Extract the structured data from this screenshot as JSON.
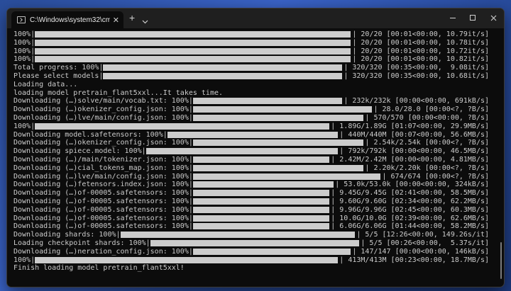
{
  "window": {
    "tab_title": "C:\\Windows\\system32\\cmd.e",
    "new_tab": "+",
    "colors": {
      "background": "#0c0c0c",
      "text": "#cccccc",
      "titlebar": "#1f1f1f"
    }
  },
  "terminal": {
    "lines": [
      {
        "type": "bar",
        "pre": "100%|",
        "post": "| 20/20 [00:01<00:00, 10.79it/s]",
        "progress": 1.0
      },
      {
        "type": "bar",
        "pre": "100%|",
        "post": "| 20/20 [00:01<00:00, 10.78it/s]",
        "progress": 1.0
      },
      {
        "type": "bar",
        "pre": "100%|",
        "post": "| 20/20 [00:01<00:00, 10.72it/s]",
        "progress": 1.0
      },
      {
        "type": "bar",
        "pre": "100%|",
        "post": "| 20/20 [00:01<00:00, 10.82it/s]",
        "progress": 1.0
      },
      {
        "type": "bar",
        "pre": "Total progress: 100%|",
        "post": "| 320/320 [00:35<00:00,  9.08it/s]",
        "progress": 1.0
      },
      {
        "type": "bar",
        "pre": "Please select models|",
        "post": "| 320/320 [00:35<00:00, 10.68it/s]",
        "progress": 1.0
      },
      {
        "type": "text",
        "text": "Loading data..."
      },
      {
        "type": "text",
        "text": "loading model pretrain_flant5xxl...It takes time."
      },
      {
        "type": "bar",
        "pre": "Downloading (…)solve/main/vocab.txt: 100%|",
        "post": "| 232k/232k [00:00<00:00, 691kB/s]",
        "progress": 1.0
      },
      {
        "type": "bar",
        "pre": "Downloading (…)okenizer_config.json: 100%|",
        "post": "| 28.0/28.0 [00:00<?, ?B/s]",
        "progress": 1.0
      },
      {
        "type": "bar",
        "pre": "Downloading (…)lve/main/config.json: 100%|",
        "post": "| 570/570 [00:00<00:00, ?B/s]",
        "progress": 1.0
      },
      {
        "type": "bar",
        "pre": "100%|",
        "post": "| 1.89G/1.89G [01:07<00:00, 29.9MB/s]",
        "progress": 1.0
      },
      {
        "type": "bar",
        "pre": "Downloading model.safetensors: 100%|",
        "post": "| 440M/440M [00:07<00:00, 56.6MB/s]",
        "progress": 1.0
      },
      {
        "type": "bar",
        "pre": "Downloading (…)okenizer_config.json: 100%|",
        "post": "| 2.54k/2.54k [00:00<?, ?B/s]",
        "progress": 1.0
      },
      {
        "type": "bar",
        "pre": "Downloading spiece.model: 100%|",
        "post": "| 792k/792k [00:00<00:00, 46.5MB/s]",
        "progress": 1.0
      },
      {
        "type": "bar",
        "pre": "Downloading (…)/main/tokenizer.json: 100%|",
        "post": "| 2.42M/2.42M [00:00<00:00, 4.81MB/s]",
        "progress": 1.0
      },
      {
        "type": "bar",
        "pre": "Downloading (…)cial_tokens_map.json: 100%|",
        "post": "| 2.20k/2.20k [00:00<?, ?B/s]",
        "progress": 1.0
      },
      {
        "type": "bar",
        "pre": "Downloading (…)lve/main/config.json: 100%|",
        "post": "| 674/674 [00:00<?, ?B/s]",
        "progress": 1.0
      },
      {
        "type": "bar",
        "pre": "Downloading (…)fetensors.index.json: 100%|",
        "post": "| 53.0k/53.0k [00:00<00:00, 324kB/s]",
        "progress": 1.0
      },
      {
        "type": "bar",
        "pre": "Downloading (…)of-00005.safetensors: 100%|",
        "post": "| 9.45G/9.45G [02:41<00:00, 58.5MB/s]",
        "progress": 1.0
      },
      {
        "type": "bar",
        "pre": "Downloading (…)of-00005.safetensors: 100%|",
        "post": "| 9.60G/9.60G [02:34<00:00, 62.2MB/s]",
        "progress": 1.0
      },
      {
        "type": "bar",
        "pre": "Downloading (…)of-00005.safetensors: 100%|",
        "post": "| 9.96G/9.96G [02:45<00:00, 60.3MB/s]",
        "progress": 1.0
      },
      {
        "type": "bar",
        "pre": "Downloading (…)of-00005.safetensors: 100%|",
        "post": "| 10.0G/10.0G [02:39<00:00, 62.6MB/s]",
        "progress": 1.0
      },
      {
        "type": "bar",
        "pre": "Downloading (…)of-00005.safetensors: 100%|",
        "post": "| 6.06G/6.06G [01:44<00:00, 58.2MB/s]",
        "progress": 1.0
      },
      {
        "type": "bar",
        "pre": "Downloading shards: 100%|",
        "post": "| 5/5 [12:26<00:00, 149.26s/it]",
        "progress": 1.0
      },
      {
        "type": "bar",
        "pre": "Loading checkpoint shards: 100%|",
        "post": "| 5/5 [00:26<00:00,  5.37s/it]",
        "progress": 1.0
      },
      {
        "type": "bar",
        "pre": "Downloading (…)neration_config.json: 100%|",
        "post": "| 147/147 [00:00<00:00, 146kB/s]",
        "progress": 1.0
      },
      {
        "type": "bar",
        "pre": "100%|",
        "post": "| 413M/413M [00:23<00:00, 18.7MB/s]",
        "progress": 1.0
      },
      {
        "type": "text",
        "text": "Finish loading model pretrain_flant5xxl!"
      }
    ]
  }
}
